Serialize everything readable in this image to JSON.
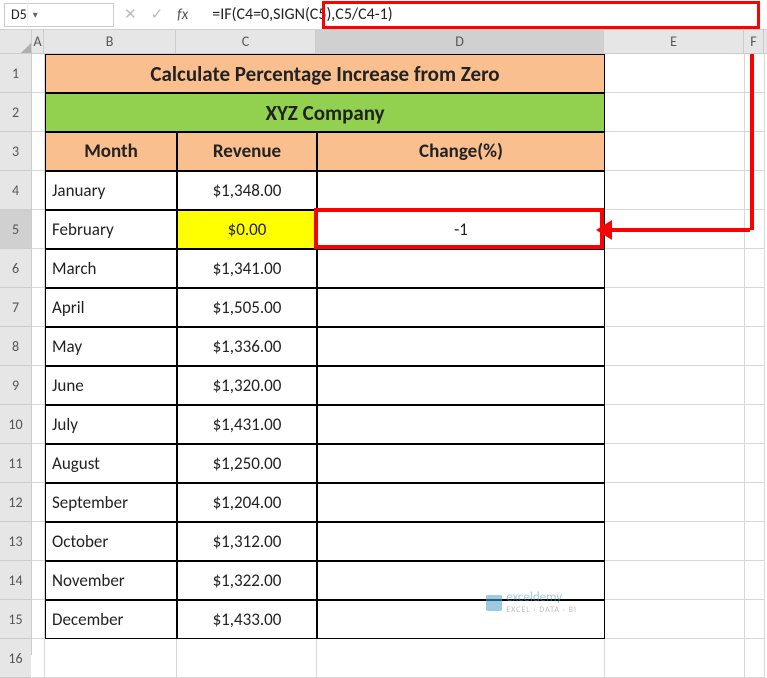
{
  "namebox": "D5",
  "formula": "=IF(C4=0,SIGN(C5),C5/C4-1)",
  "colHeaders": [
    "A",
    "B",
    "C",
    "D",
    "E",
    "F"
  ],
  "rowHeaders": [
    "1",
    "2",
    "3",
    "4",
    "5",
    "6",
    "7",
    "8",
    "9",
    "10",
    "11",
    "12",
    "13",
    "14",
    "15",
    "16"
  ],
  "selectedCol": "D",
  "selectedRow": "5",
  "title1": "Calculate Percentage Increase from Zero",
  "title2": "XYZ Company",
  "headers": {
    "month": "Month",
    "revenue": "Revenue",
    "change": "Change(%)"
  },
  "rows": [
    {
      "month": "January",
      "revenue": "$1,348.00",
      "change": "",
      "hl": false
    },
    {
      "month": "February",
      "revenue": "$0.00",
      "change": "-1",
      "hl": true
    },
    {
      "month": "March",
      "revenue": "$1,341.00",
      "change": "",
      "hl": false
    },
    {
      "month": "April",
      "revenue": "$1,505.00",
      "change": "",
      "hl": false
    },
    {
      "month": "May",
      "revenue": "$1,336.00",
      "change": "",
      "hl": false
    },
    {
      "month": "June",
      "revenue": "$1,320.00",
      "change": "",
      "hl": false
    },
    {
      "month": "July",
      "revenue": "$1,431.00",
      "change": "",
      "hl": false
    },
    {
      "month": "August",
      "revenue": "$1,250.00",
      "change": "",
      "hl": false
    },
    {
      "month": "September",
      "revenue": "$1,204.00",
      "change": "",
      "hl": false
    },
    {
      "month": "October",
      "revenue": "$1,312.00",
      "change": "",
      "hl": false
    },
    {
      "month": "November",
      "revenue": "$1,322.00",
      "change": "",
      "hl": false
    },
    {
      "month": "December",
      "revenue": "$1,433.00",
      "change": "",
      "hl": false
    }
  ],
  "watermark": {
    "name": "exceldemy",
    "sub": "EXCEL · DATA · BI"
  }
}
